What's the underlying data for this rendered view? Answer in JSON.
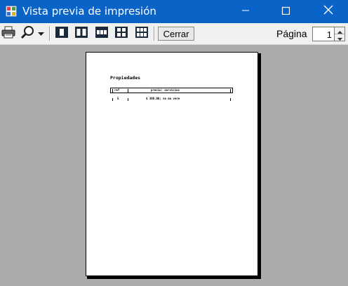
{
  "window": {
    "title": "Vista previa de impresión",
    "icon": "print-preview-app-icon"
  },
  "toolbar": {
    "buttons": [
      {
        "name": "print-button",
        "icon": "printer-icon"
      },
      {
        "name": "zoom-button",
        "icon": "magnifier-icon"
      },
      {
        "name": "one-page-button",
        "icon": "one-page-icon"
      },
      {
        "name": "two-pages-button",
        "icon": "two-pages-icon"
      },
      {
        "name": "three-pages-button",
        "icon": "three-pages-icon"
      },
      {
        "name": "four-pages-button",
        "icon": "four-pages-icon"
      },
      {
        "name": "six-pages-button",
        "icon": "six-pages-icon"
      }
    ],
    "close_label": "Cerrar",
    "page_label": "Página",
    "page_value": "1"
  },
  "document": {
    "heading": "Propiedades",
    "header_cells": [
      "ref",
      "precio; servicios"
    ],
    "row_cells": [
      "5",
      "$ 300,00; se mo vere"
    ]
  },
  "colors": {
    "titlebar": "#0a64c8",
    "toolbar": "#f0f0f0",
    "workspace": "#ababab"
  }
}
